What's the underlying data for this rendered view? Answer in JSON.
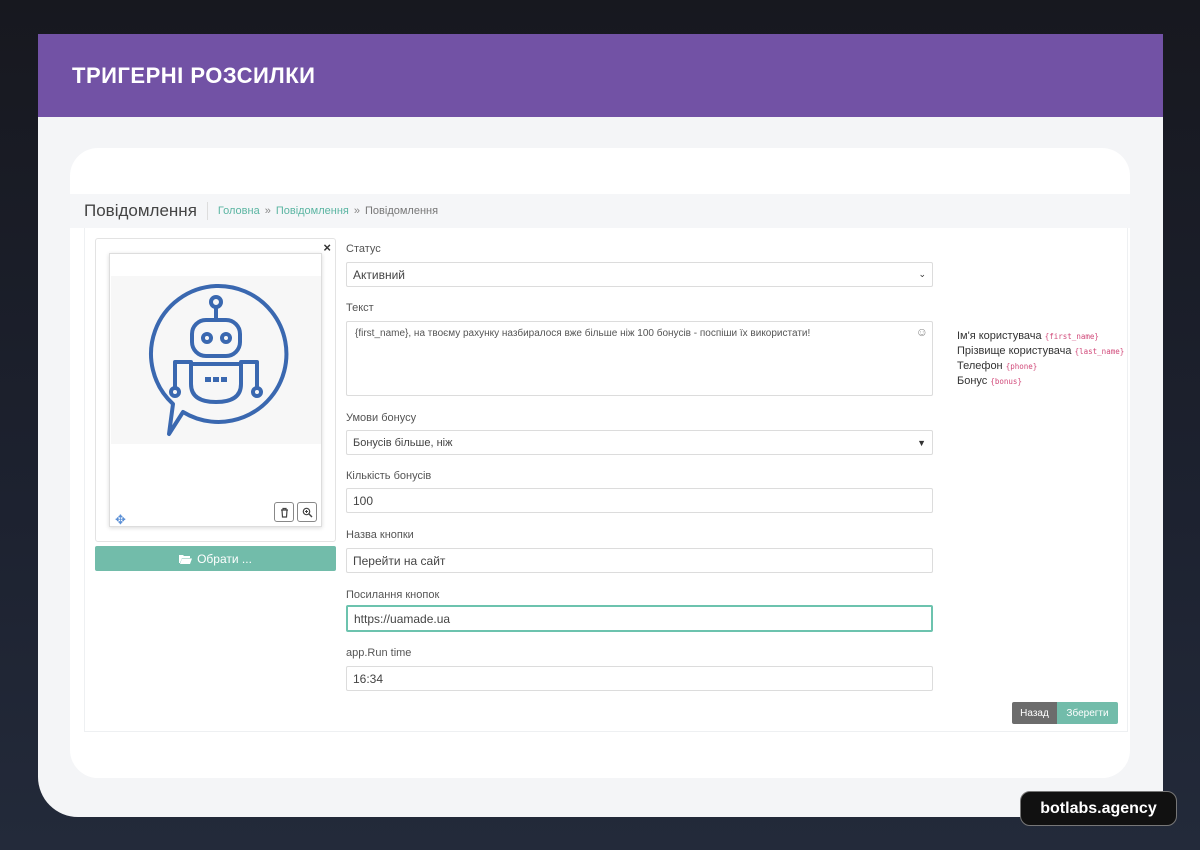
{
  "banner": {
    "title": "ТРИГЕРНІ РОЗСИЛКИ"
  },
  "page": {
    "title": "Повідомлення",
    "breadcrumb": [
      {
        "label": "Головна",
        "link": true
      },
      {
        "label": "Повідомлення",
        "link": true
      },
      {
        "label": "Повідомлення",
        "link": false
      }
    ],
    "breadcrumb_sep": "»"
  },
  "uploader": {
    "close": "×",
    "choose_label": "Обрати ...",
    "icons": {
      "close": "close-icon",
      "delete": "trash-icon",
      "zoom": "zoom-icon",
      "move": "move-icon",
      "folder": "folder-open-icon",
      "image": "robot-chat-icon"
    }
  },
  "form": {
    "status": {
      "label": "Статус",
      "value": "Активний"
    },
    "text": {
      "label": "Текст",
      "value": "{first_name}, на твоєму рахунку назбиралося вже більше ніж 100 бонусів - поспіши їх використати!"
    },
    "bonus_condition": {
      "label": "Умови бонусу",
      "value": "Бонусів більше, ніж"
    },
    "bonus_count": {
      "label": "Кількість бонусів",
      "value": "100"
    },
    "button_name": {
      "label": "Назва кнопки",
      "value": "Перейти на сайт"
    },
    "button_link": {
      "label": "Посилання кнопок",
      "value": "https://uamade.ua"
    },
    "run_time": {
      "label": "app.Run time",
      "value": "16:34"
    }
  },
  "variables": [
    {
      "label": "Ім'я користувача",
      "tag": "{first_name}"
    },
    {
      "label": "Прізвище користувача",
      "tag": "{last_name}"
    },
    {
      "label": "Телефон",
      "tag": "{phone}"
    },
    {
      "label": "Бонус",
      "tag": "{bonus}"
    }
  ],
  "actions": {
    "back": "Назад",
    "save": "Зберегти"
  },
  "watermark": "botlabs.agency",
  "colors": {
    "banner": "#7252a5",
    "accent": "#72bcaa",
    "link": "#5bb5a2",
    "robot": "#3a68b0"
  }
}
